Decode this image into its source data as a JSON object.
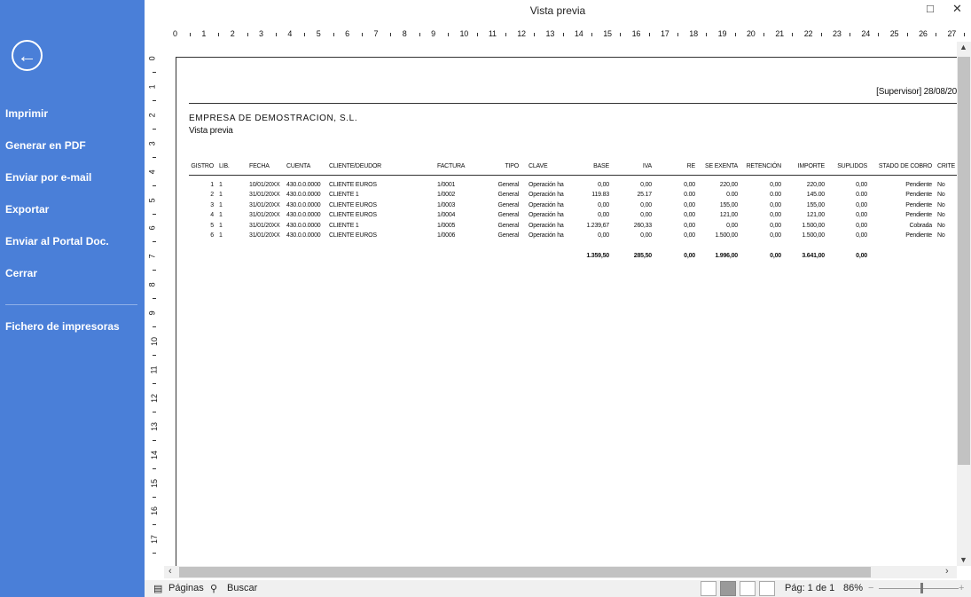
{
  "window": {
    "title": "Vista previa",
    "maximize_icon": "□",
    "close_icon": "✕"
  },
  "sidebar": {
    "back_icon": "←",
    "items": [
      {
        "label": "Imprimir"
      },
      {
        "label": "Generar en PDF"
      },
      {
        "label": "Enviar por e-mail"
      },
      {
        "label": "Exportar"
      },
      {
        "label": "Enviar al Portal Doc."
      },
      {
        "label": "Cerrar"
      }
    ],
    "extra": "Fichero de impresoras"
  },
  "ruler": {
    "top": [
      "0",
      "1",
      "2",
      "3",
      "4",
      "5",
      "6",
      "7",
      "8",
      "9",
      "10",
      "11",
      "12",
      "13",
      "14",
      "15",
      "16",
      "17",
      "18",
      "19",
      "20",
      "21",
      "22",
      "23",
      "24",
      "25",
      "26",
      "27"
    ],
    "left": [
      "0",
      "1",
      "2",
      "3",
      "4",
      "5",
      "6",
      "7",
      "8",
      "9",
      "10",
      "11",
      "12",
      "13",
      "14",
      "15",
      "16",
      "17"
    ]
  },
  "report": {
    "user_date": "[Supervisor] 28/08/20",
    "company": "EMPRESA DE DEMOSTRACION, S.L.",
    "subtitle": "Vista previa",
    "columns": [
      "GISTRO",
      "LIB.",
      "FECHA",
      "CUENTA",
      "CLIENTE/DEUDOR",
      "FACTURA",
      "TIPO",
      "CLAVE",
      "BASE",
      "IVA",
      "RE",
      "SE EXENTA",
      "RETENCIÓN",
      "IMPORTE",
      "SUPLIDOS",
      "STADO DE COBRO",
      "CRITE"
    ],
    "rows": [
      [
        "1",
        "1",
        "10/01/20XX",
        "430.0.0.0000",
        "CLIENTE EUROS",
        "1/0001",
        "General",
        "Operación ha",
        "0,00",
        "0,00",
        "0,00",
        "220,00",
        "0,00",
        "220,00",
        "0,00",
        "Pendiente",
        "No"
      ],
      [
        "2",
        "1",
        "31/01/20XX",
        "430.0.0.0000",
        "CLIENTE 1",
        "1/0002",
        "General",
        "Operación ha",
        "119.83",
        "25.17",
        "0.00",
        "0.00",
        "0.00",
        "145.00",
        "0.00",
        "Pendiente",
        "No"
      ],
      [
        "3",
        "1",
        "31/01/20XX",
        "430.0.0.0000",
        "CLIENTE EUROS",
        "1/0003",
        "General",
        "Operación ha",
        "0,00",
        "0,00",
        "0,00",
        "155,00",
        "0,00",
        "155,00",
        "0,00",
        "Pendiente",
        "No"
      ],
      [
        "4",
        "1",
        "31/01/20XX",
        "430.0.0.0000",
        "CLIENTE EUROS",
        "1/0004",
        "General",
        "Operación ha",
        "0,00",
        "0,00",
        "0,00",
        "121,00",
        "0,00",
        "121,00",
        "0,00",
        "Pendiente",
        "No"
      ],
      [
        "5",
        "1",
        "31/01/20XX",
        "430.0.0.0000",
        "CLIENTE 1",
        "1/0005",
        "General",
        "Operación ha",
        "1.239,67",
        "260,33",
        "0,00",
        "0,00",
        "0,00",
        "1.500,00",
        "0,00",
        "Cobrada",
        "No"
      ],
      [
        "6",
        "1",
        "31/01/20XX",
        "430.0.0.0000",
        "CLIENTE EUROS",
        "1/0006",
        "General",
        "Operación ha",
        "0,00",
        "0,00",
        "0,00",
        "1.500,00",
        "0,00",
        "1.500,00",
        "0,00",
        "Pendiente",
        "No"
      ]
    ],
    "totals": {
      "BASE": "1.359,50",
      "IVA": "285,50",
      "RE": "0,00",
      "EXENTA": "1.996,00",
      "RETENCION": "0,00",
      "IMPORTE": "3.641,00",
      "SUPLIDOS": "0,00"
    }
  },
  "statusbar": {
    "pages": "Páginas",
    "search": "Buscar",
    "page_info": "Pág: 1 de 1",
    "zoom": "86%",
    "zoom_level_percent": 86
  }
}
